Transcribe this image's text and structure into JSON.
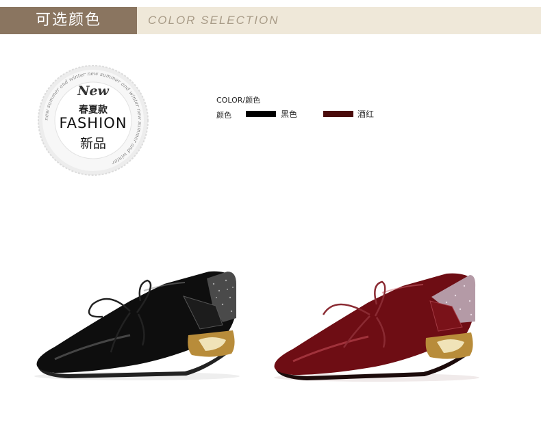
{
  "header": {
    "title_cn": "可选颜色",
    "title_en": "COLOR SELECTION"
  },
  "badge": {
    "script": "New",
    "line_cn_1": "春夏款",
    "line_en": "FASHION",
    "line_cn_2": "新品",
    "ring_text": "new summer and winter new summer and winter new summer and winter"
  },
  "colors": {
    "title": "COLOR/颜色",
    "label": "颜色",
    "options": [
      {
        "name": "黑色",
        "hex": "#000000"
      },
      {
        "name": "酒红",
        "hex": "#4a0b0b"
      }
    ]
  },
  "products": [
    {
      "name": "black-patent-shoe",
      "color": "#0c0c0c"
    },
    {
      "name": "wine-red-patent-shoe",
      "color": "#6e0d14"
    }
  ]
}
